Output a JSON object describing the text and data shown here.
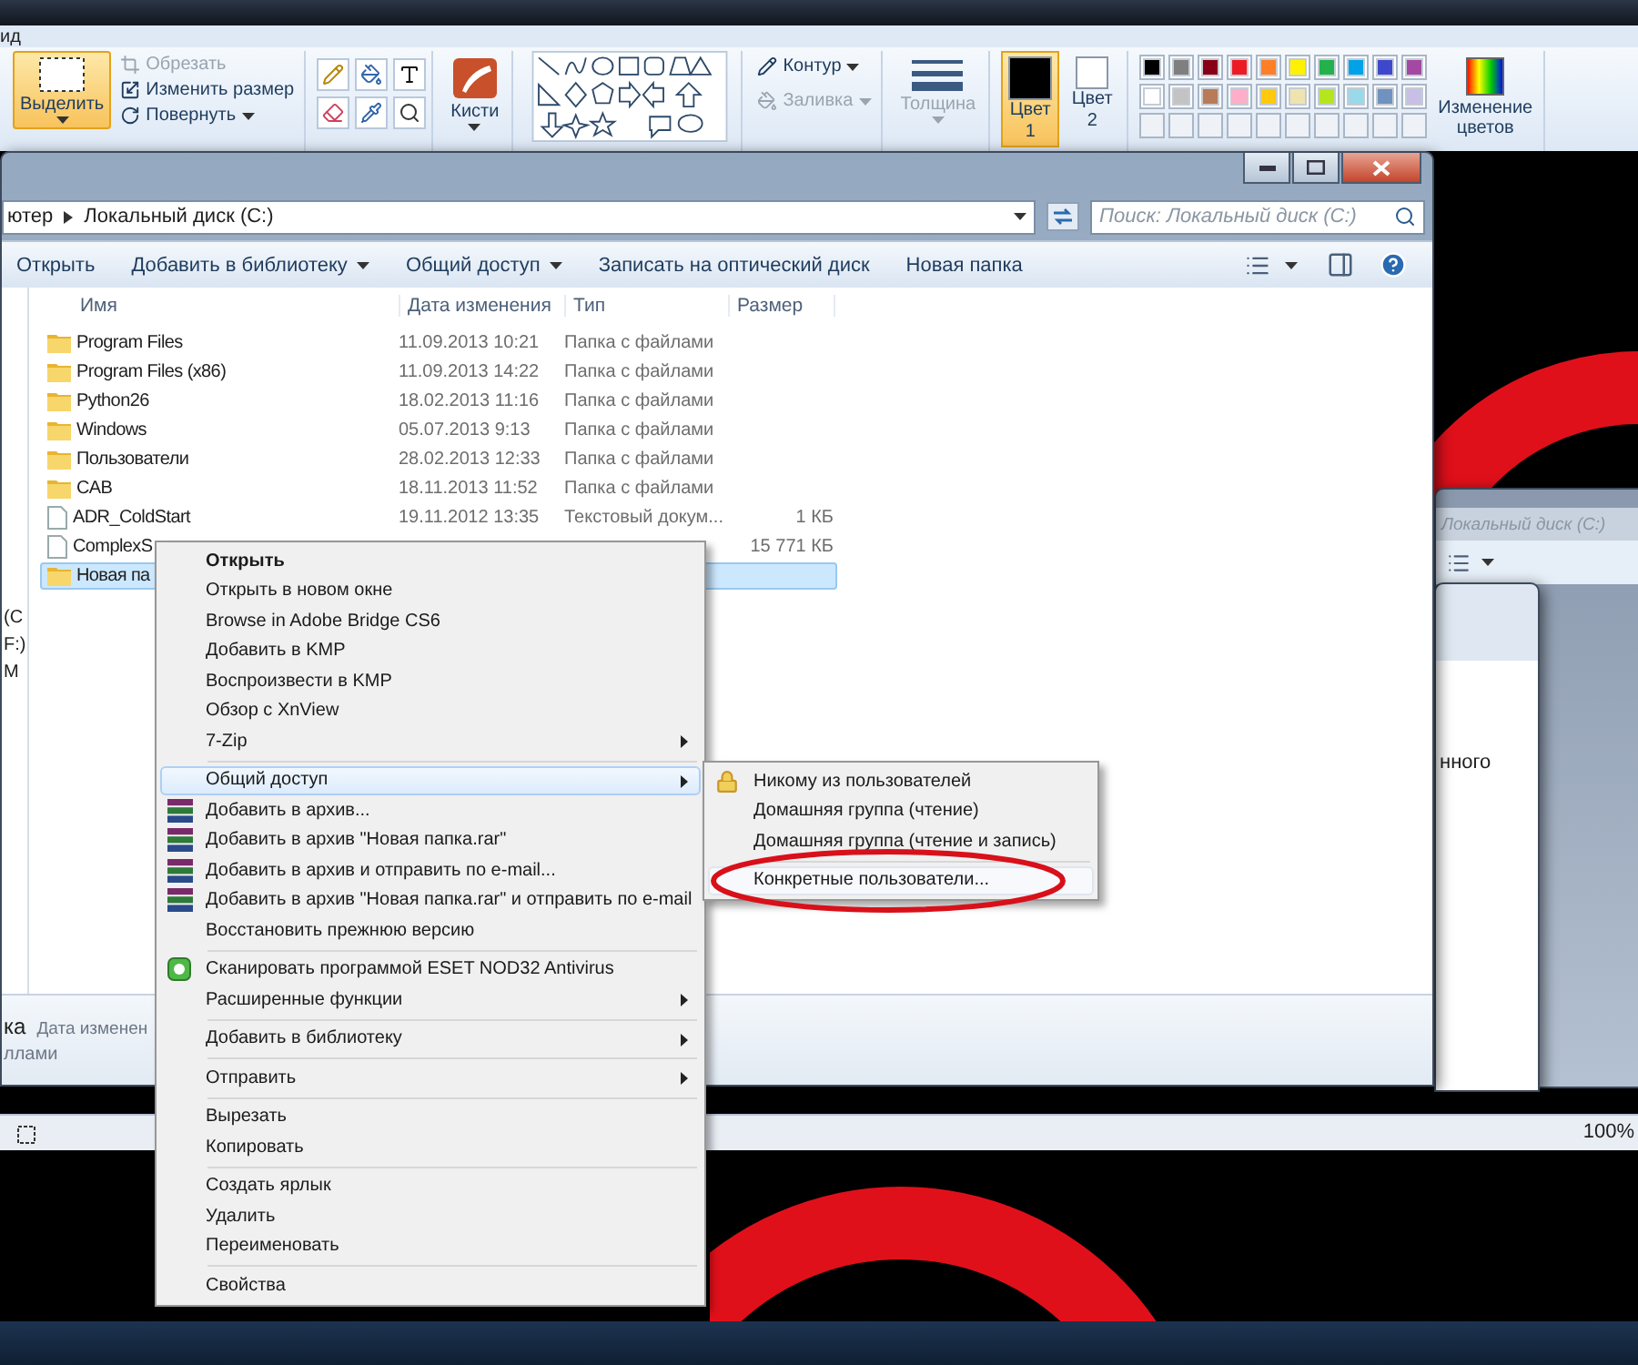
{
  "paint": {
    "menu_tab": "ид",
    "select": {
      "label": "Выделить",
      "selected": true
    },
    "image_actions": [
      {
        "kind": "crop",
        "label": "Обрезать",
        "disabled": true
      },
      {
        "kind": "resize",
        "label": "Изменить размер",
        "disabled": false
      },
      {
        "kind": "rotate",
        "label": "Повернуть",
        "disabled": false
      }
    ],
    "brushes": {
      "label": "Кисти"
    },
    "shape_options": [
      {
        "kind": "outline",
        "label": "Контур",
        "disabled": false
      },
      {
        "kind": "fill",
        "label": "Заливка",
        "disabled": true
      }
    ],
    "thickness": {
      "label": "Толщина",
      "disabled": true
    },
    "color_slots": [
      {
        "label": "Цвет",
        "number": "1",
        "selected": true,
        "color": "#000000"
      },
      {
        "label": "Цвет",
        "number": "2",
        "selected": false,
        "color": "#ffffff"
      }
    ],
    "palette": [
      {
        "color": "#000000"
      },
      {
        "color": "#7f7f7f"
      },
      {
        "color": "#880015"
      },
      {
        "color": "#ed1c24"
      },
      {
        "color": "#ff7f27"
      },
      {
        "color": "#fff200"
      },
      {
        "color": "#22b14c"
      },
      {
        "color": "#00a2e8"
      },
      {
        "color": "#3f48cc"
      },
      {
        "color": "#a349a4"
      },
      {
        "color": "#ffffff"
      },
      {
        "color": "#c3c3c3"
      },
      {
        "color": "#b97a57"
      },
      {
        "color": "#ffaec9"
      },
      {
        "color": "#ffc90e"
      },
      {
        "color": "#efe4b0"
      },
      {
        "color": "#b5e61d"
      },
      {
        "color": "#99d9ea"
      },
      {
        "color": "#7092be"
      },
      {
        "color": "#c8bfe7"
      }
    ],
    "edit_colors": {
      "label": "Изменение цветов"
    },
    "status": {
      "zoom": "100%"
    }
  },
  "explorer": {
    "address": [
      "ютер",
      "Локальный диск (C:)"
    ],
    "search": {
      "placeholder": "Поиск: Локальный диск (C:)"
    },
    "toolbar": [
      {
        "label": "Открыть",
        "dropdown": false
      },
      {
        "label": "Добавить в библиотеку",
        "dropdown": true
      },
      {
        "label": "Общий доступ",
        "dropdown": true
      },
      {
        "label": "Записать на оптический диск",
        "dropdown": false
      },
      {
        "label": "Новая папка",
        "dropdown": false
      }
    ],
    "columns": [
      "Имя",
      "Дата изменения",
      "Тип",
      "Размер"
    ],
    "rows": [
      {
        "kind": "folder",
        "name": "Program Files",
        "date": "11.09.2013 10:21",
        "type": "Папка с файлами",
        "selected": false
      },
      {
        "kind": "folder",
        "name": "Program Files (x86)",
        "date": "11.09.2013 14:22",
        "type": "Папка с файлами",
        "selected": false
      },
      {
        "kind": "folder",
        "name": "Python26",
        "date": "18.02.2013 11:16",
        "type": "Папка с файлами",
        "selected": false
      },
      {
        "kind": "folder",
        "name": "Windows",
        "date": "05.07.2013 9:13",
        "type": "Папка с файлами",
        "selected": false
      },
      {
        "kind": "folder",
        "name": "Пользователи",
        "date": "28.02.2013 12:33",
        "type": "Папка с файлами",
        "selected": false
      },
      {
        "kind": "folder",
        "name": "CAB",
        "date": "18.11.2013 11:52",
        "type": "Папка с файлами",
        "selected": false
      },
      {
        "kind": "file",
        "name": "ADR_ColdStart",
        "date": "19.11.2012 13:35",
        "type": "Текстовый докум...",
        "size": "1 КБ",
        "selected": false
      },
      {
        "kind": "file",
        "name": "ComplexS",
        "size": "15 771 КБ",
        "selected": false
      },
      {
        "kind": "folder",
        "name": "Новая па",
        "selected": true
      }
    ],
    "nav_pane": [
      "(C",
      "F:)",
      "M"
    ],
    "details": {
      "name": "ка",
      "field": "Дата изменен",
      "type": "ллами"
    }
  },
  "context_menu": [
    {
      "kind": "item",
      "label": "Открыть",
      "bold": true,
      "submenu": false,
      "selected": false
    },
    {
      "kind": "item",
      "label": "Открыть в новом окне",
      "bold": false,
      "submenu": false,
      "selected": false
    },
    {
      "kind": "item",
      "label": "Browse in Adobe Bridge CS6",
      "bold": false,
      "submenu": false,
      "selected": false
    },
    {
      "kind": "item",
      "label": "Добавить в KMP",
      "bold": false,
      "submenu": false,
      "selected": false
    },
    {
      "kind": "item",
      "label": "Воспроизвести в KMP",
      "bold": false,
      "submenu": false,
      "selected": false
    },
    {
      "kind": "item",
      "label": "Обзор с XnView",
      "bold": false,
      "submenu": false,
      "selected": false
    },
    {
      "kind": "item",
      "label": "7-Zip",
      "bold": false,
      "submenu": true,
      "selected": false
    },
    {
      "kind": "separator"
    },
    {
      "kind": "item",
      "label": "Общий доступ",
      "bold": false,
      "submenu": true,
      "selected": true
    },
    {
      "kind": "archive",
      "label": "Добавить в архив...",
      "bold": false,
      "submenu": false,
      "selected": false
    },
    {
      "kind": "archive",
      "label": "Добавить в архив \"Новая папка.rar\"",
      "bold": false,
      "submenu": false,
      "selected": false
    },
    {
      "kind": "archive",
      "label": "Добавить в архив и отправить по e-mail...",
      "bold": false,
      "submenu": false,
      "selected": false
    },
    {
      "kind": "archive",
      "label": "Добавить в архив \"Новая папка.rar\" и отправить по e-mail",
      "bold": false,
      "submenu": false,
      "selected": false
    },
    {
      "kind": "item",
      "label": "Восстановить прежнюю версию",
      "bold": false,
      "submenu": false,
      "selected": false
    },
    {
      "kind": "separator"
    },
    {
      "kind": "scan",
      "label": "Сканировать программой ESET NOD32 Antivirus",
      "bold": false,
      "submenu": false,
      "selected": false
    },
    {
      "kind": "item",
      "label": "Расширенные функции",
      "bold": false,
      "submenu": true,
      "selected": false
    },
    {
      "kind": "separator"
    },
    {
      "kind": "item",
      "label": "Добавить в библиотеку",
      "bold": false,
      "submenu": true,
      "selected": false
    },
    {
      "kind": "separator"
    },
    {
      "kind": "item",
      "label": "Отправить",
      "bold": false,
      "submenu": true,
      "selected": false
    },
    {
      "kind": "separator"
    },
    {
      "kind": "item",
      "label": "Вырезать",
      "bold": false,
      "submenu": false,
      "selected": false
    },
    {
      "kind": "item",
      "label": "Копировать",
      "bold": false,
      "submenu": false,
      "selected": false
    },
    {
      "kind": "separator"
    },
    {
      "kind": "item",
      "label": "Создать ярлык",
      "bold": false,
      "submenu": false,
      "selected": false
    },
    {
      "kind": "item",
      "label": "Удалить",
      "bold": false,
      "submenu": false,
      "selected": false
    },
    {
      "kind": "item",
      "label": "Переименовать",
      "bold": false,
      "submenu": false,
      "selected": false
    },
    {
      "kind": "separator"
    },
    {
      "kind": "item",
      "label": "Свойства",
      "bold": false,
      "submenu": false,
      "selected": false
    }
  ],
  "share_submenu": [
    {
      "kind": "lock",
      "label": "Никому из пользователей",
      "circled": false,
      "selected": false
    },
    {
      "kind": "item",
      "label": "Домашняя группа (чтение)",
      "circled": false,
      "selected": false
    },
    {
      "kind": "item",
      "label": "Домашняя группа (чтение и запись)",
      "circled": false,
      "selected": false
    },
    {
      "kind": "separator"
    },
    {
      "kind": "item",
      "label": "Конкретные пользователи...",
      "circled": true,
      "selected": true
    }
  ],
  "background_window": {
    "search_text": "Локальный диск (C:)",
    "dialog_text": "нного"
  }
}
